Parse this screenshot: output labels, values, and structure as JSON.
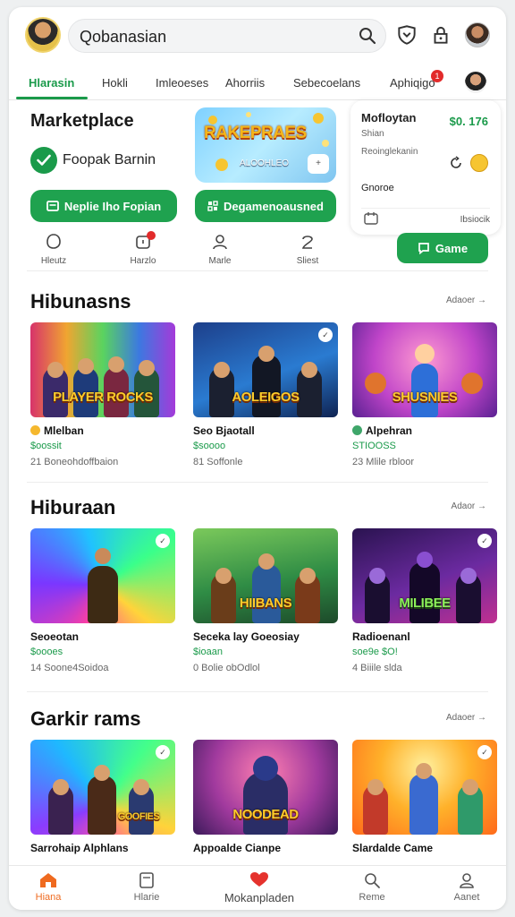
{
  "header": {
    "search_value": "Qobanasian",
    "tabs": [
      "Hlarasin",
      "Hokli",
      "Imleoeses",
      "Ahorriis",
      "Sebecoelans",
      "Aphiqigo"
    ],
    "tab_badge": "1"
  },
  "marketplace": {
    "title": "Marketplace",
    "check_label": "Foopak Barnin",
    "button_left": "Neplie Iho Fopian",
    "button_right": "Degamenoausned",
    "promo_title": "RAKEPRAES",
    "promo_sub": "ALOOHLEO",
    "promo_btn": "+",
    "quick_actions": [
      {
        "label": "Hleutz",
        "icon": "circle-icon"
      },
      {
        "label": "Harzlo",
        "icon": "notification-icon"
      },
      {
        "label": "Marle",
        "icon": "person-icon"
      },
      {
        "label": "Sliest",
        "icon": "two-icon"
      }
    ]
  },
  "side_card": {
    "name": "Mofloytan",
    "price": "$0. 176",
    "line1": "Shian",
    "line2": "Reoinglekanin",
    "line3": "Gnoroe",
    "right_label": "Ibsiocik",
    "game_button": "Game"
  },
  "sections": [
    {
      "title": "Hibunasns",
      "more": "Adaoer →",
      "cards": [
        {
          "thumb_text": "PLAYER ROCKS",
          "title": "Mlelban",
          "price": "$oossit",
          "meta": "21 Boneohdoffbaion",
          "emoji": true
        },
        {
          "thumb_text": "AOLEIGOS",
          "title": "Seo Bjaotall",
          "price": "$soooo",
          "meta": "81 Soffonle",
          "emoji": false
        },
        {
          "thumb_text": "SHUSNIES",
          "title": "Alpehran",
          "price": "STIOOSS",
          "meta": "23 Mlile rbloor",
          "emoji": true
        }
      ]
    },
    {
      "title": "Hiburaan",
      "more": "Adaor →",
      "cards": [
        {
          "thumb_text": "",
          "title": "Seoeotan",
          "price": "$oooes",
          "meta": "14 Soone4Soidoa",
          "emoji": false
        },
        {
          "thumb_text": "HIIBANS",
          "title": "Seceka lay Goeosiay",
          "price": "$ioaan",
          "meta": "0 Bolie obOdlol",
          "emoji": false
        },
        {
          "thumb_text": "MILIBEE",
          "title": "Radioenanl",
          "price": "soe9e $O!",
          "meta": "4 Biiile slda",
          "emoji": false
        }
      ]
    },
    {
      "title": "Garkir rams",
      "more": "Adaoer →",
      "cards": [
        {
          "thumb_text": "GOOFIES",
          "title": "Sarrohaip Alphlans",
          "price": "",
          "meta": "",
          "emoji": false
        },
        {
          "thumb_text": "NOODEAD",
          "title": "Appoalde Cianpe",
          "price": "",
          "meta": "",
          "emoji": false
        },
        {
          "thumb_text": "",
          "title": "Slardalde Came",
          "price": "",
          "meta": "",
          "emoji": false
        }
      ]
    }
  ],
  "bottom_nav": [
    {
      "label": "Hiana",
      "icon": "home-icon"
    },
    {
      "label": "Hlarie",
      "icon": "document-icon"
    },
    {
      "label": "Mokanpladen",
      "icon": "heart-icon"
    },
    {
      "label": "Reme",
      "icon": "search-icon"
    },
    {
      "label": "Aanet",
      "icon": "profile-icon"
    }
  ],
  "colors": {
    "accent_green": "#1fa24f",
    "active_orange": "#ef6a1f",
    "badge_red": "#e22b2b"
  }
}
